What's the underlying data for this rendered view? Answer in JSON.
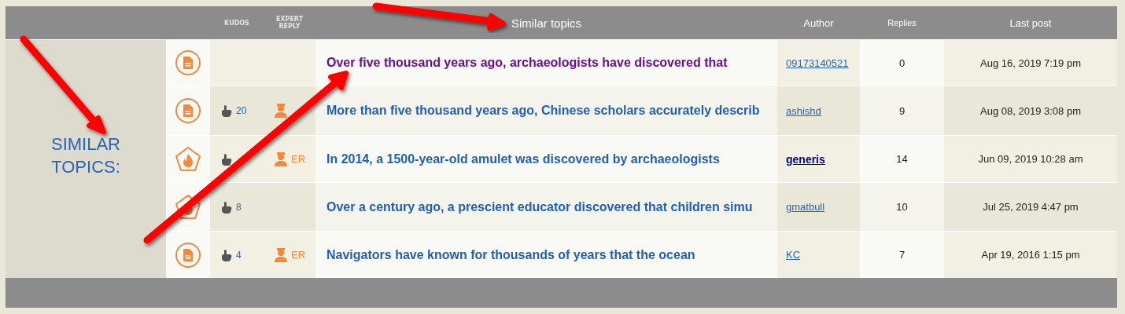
{
  "header": {
    "kudos": "KUDOS",
    "expert_reply": "EXPERT REPLY",
    "title": "Similar topics",
    "author": "Author",
    "replies": "Replies",
    "last_post": "Last post"
  },
  "side_label": "SIMILAR TOPICS:",
  "topics": [
    {
      "kind": "doc",
      "kudos_icon": false,
      "expert_icon": false,
      "title": "Over five thousand years ago, archaeologists have discovered that",
      "visited": true,
      "author": "09173140521",
      "author_bold": false,
      "replies": "0",
      "last_post": "Aug 16, 2019 7:19 pm"
    },
    {
      "kind": "doc",
      "kudos_icon": true,
      "kudos": "20",
      "expert_icon": true,
      "title": "More than five thousand years ago, Chinese scholars accurately describ",
      "visited": false,
      "author": "ashishd",
      "author_bold": false,
      "replies": "9",
      "last_post": "Aug 08, 2019 3:08 pm"
    },
    {
      "kind": "hot",
      "kudos_icon": true,
      "expert_icon": true,
      "expert_reply": "ER",
      "title": "In 2014, a 1500-year-old amulet was discovered by archaeologists",
      "visited": false,
      "author": "generis",
      "author_bold": true,
      "replies": "14",
      "last_post": "Jun 09, 2019 10:28 am"
    },
    {
      "kind": "hot",
      "kudos_icon": true,
      "kudos": "8",
      "expert_icon": false,
      "title": "Over a century ago, a prescient educator discovered that children simu",
      "visited": false,
      "author": "gmatbull",
      "author_bold": false,
      "replies": "10",
      "last_post": "Jul 25, 2019 4:47 pm"
    },
    {
      "kind": "doc",
      "kudos_icon": true,
      "kudos": "4",
      "expert_icon": true,
      "expert_reply": "ER",
      "title": "Navigators have known for thousands of years that the ocean",
      "visited": false,
      "author": "KC",
      "author_bold": false,
      "replies": "7",
      "last_post": "Apr 19, 2016 1:15 pm"
    }
  ]
}
